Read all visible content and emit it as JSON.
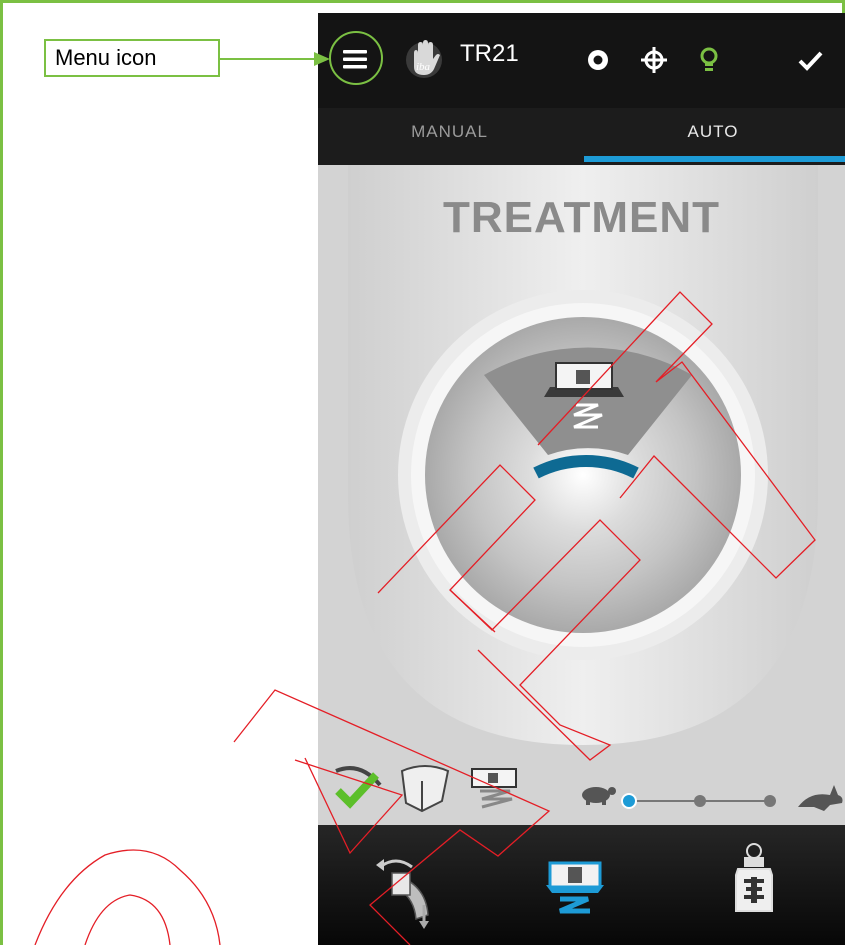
{
  "annotation": {
    "label": "Menu icon"
  },
  "header": {
    "title": "TR21",
    "logo_text": "iba"
  },
  "tabs": [
    {
      "label": "MANUAL",
      "active": false
    },
    {
      "label": "AUTO",
      "active": true
    }
  ],
  "main": {
    "title": "TREATMENT"
  },
  "icons": {
    "menu": "hamburger-menu-icon",
    "logo": "iba-hand-logo",
    "status_1": "ring-icon",
    "status_2": "crosshair-icon",
    "status_3": "lightbulb-icon",
    "status_4": "checkmark-icon",
    "speed_slow": "turtle-icon",
    "speed_fast": "rabbit-icon"
  },
  "speed": {
    "levels": 3,
    "selected": 1
  },
  "colors": {
    "accent": "#1d9bd6",
    "annotation": "#7bc043",
    "bulb": "#7bc043",
    "watermark": "#e41e26",
    "check": "#5cbf2a"
  }
}
